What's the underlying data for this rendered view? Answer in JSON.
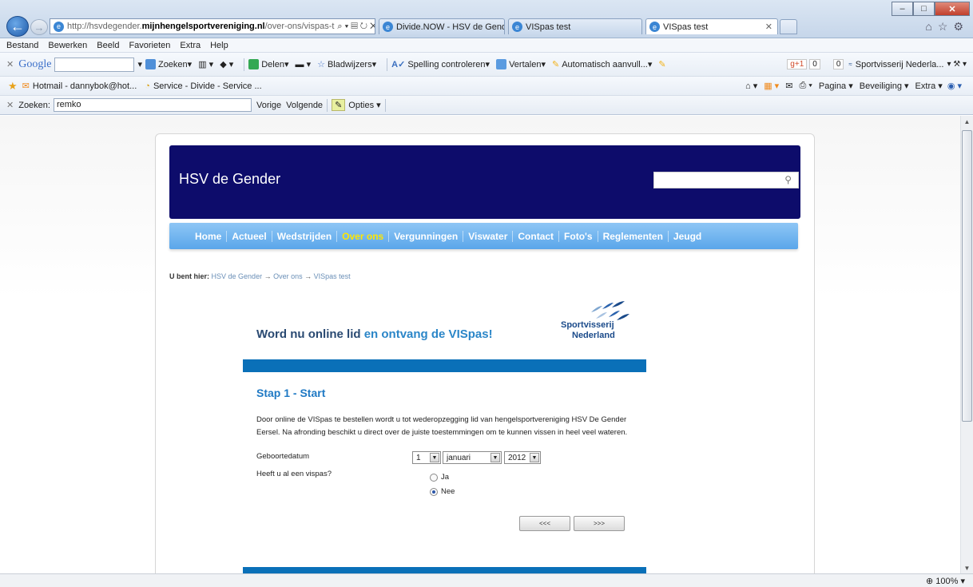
{
  "browser": {
    "address": {
      "prefix": "http://hsvdegender.",
      "host": "mijnhengelsportvereniging.nl",
      "path": "/over-ons/vispas-t"
    },
    "tabs": [
      {
        "label": "Divide.NOW - HSV de Gender"
      },
      {
        "label": "VISpas test"
      },
      {
        "label": "VISpas test"
      }
    ],
    "menu": [
      "Bestand",
      "Bewerken",
      "Beeld",
      "Favorieten",
      "Extra",
      "Help"
    ],
    "google_toolbar": {
      "brand": "Google",
      "search": "Zoeken",
      "share": "Delen",
      "bookmarks": "Bladwijzers",
      "spelling": "Spelling controleren",
      "translate": "Vertalen",
      "autofill": "Automatisch aanvull...",
      "plus_count": "0",
      "count2": "0",
      "sportvisserij": "Sportvisserij Nederla..."
    },
    "favorites": {
      "hotmail": "Hotmail - dannybok@hot...",
      "service": "Service - Divide - Service ...",
      "page": "Pagina",
      "security": "Beveiliging",
      "extra": "Extra"
    },
    "find": {
      "label": "Zoeken:",
      "value": "remko",
      "prev": "Vorige",
      "next": "Volgende",
      "options": "Opties"
    },
    "zoom": "100%"
  },
  "site": {
    "title": "HSV de Gender",
    "nav": [
      "Home",
      "Actueel",
      "Wedstrijden",
      "Over ons",
      "Vergunningen",
      "Viswater",
      "Contact",
      "Foto's",
      "Reglementen",
      "Jeugd"
    ],
    "active_nav": "Over ons",
    "breadcrumb": {
      "label": "U bent hier:",
      "items": [
        "HSV de Gender",
        "Over ons",
        "VISpas test"
      ]
    }
  },
  "form": {
    "headline_dark": "Word nu online lid",
    "headline_accent": "en ontvang de VISpas!",
    "logo_line1": "Sportvisserij",
    "logo_line2": "Nederland",
    "step_title": "Stap 1 - Start",
    "paragraph": "Door online de VISpas te bestellen wordt u tot wederopzegging lid van hengelsportvereniging HSV De Gender Eersel. Na afronding beschikt u direct over de juiste toestemmingen om te kunnen vissen in heel veel wateren.",
    "birthdate_label": "Geboortedatum",
    "day": "1",
    "month": "januari",
    "year": "2012",
    "vispas_question": "Heeft u al een vispas?",
    "option_yes": "Ja",
    "option_no": "Nee",
    "selected": "Nee",
    "back_button": "<<<",
    "next_button": ">>>"
  }
}
